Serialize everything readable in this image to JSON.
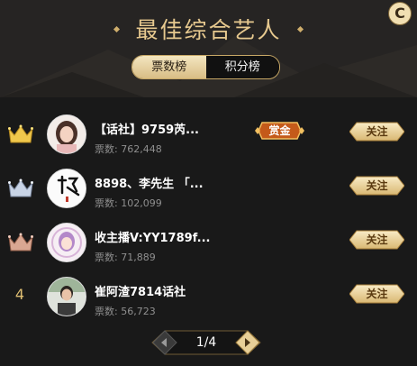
{
  "header": {
    "title": "最佳综合艺人",
    "tabs": [
      {
        "label": "票数榜",
        "active": true
      },
      {
        "label": "积分榜",
        "active": false
      }
    ],
    "refresh_label": "C"
  },
  "votes_prefix": "票数:",
  "entries": [
    {
      "rank": 1,
      "rank_icon": "crown-gold-icon",
      "name": "【话社】9759芮...",
      "votes": "762,448",
      "reward_label": "赏金",
      "follow_label": "关注",
      "avatar": "woman-avatar"
    },
    {
      "rank": 2,
      "rank_icon": "crown-silver-icon",
      "name": "8898、李先生 「...",
      "votes": "102,099",
      "follow_label": "关注",
      "avatar": "calligraphy-avatar"
    },
    {
      "rank": 3,
      "rank_icon": "crown-bronze-icon",
      "name": "收主播V:YY1789f...",
      "votes": "71,889",
      "follow_label": "关注",
      "avatar": "anime-girl-avatar"
    },
    {
      "rank": 4,
      "rank_display": "4",
      "name": "崔阿渣7814话社",
      "votes": "56,723",
      "follow_label": "关注",
      "avatar": "man-avatar"
    }
  ],
  "pagination": {
    "current": 1,
    "total": 4,
    "display": "1/4"
  },
  "colors": {
    "gold": "#e7c98f",
    "background": "#191919",
    "button_gold": "#f0d8a0"
  }
}
